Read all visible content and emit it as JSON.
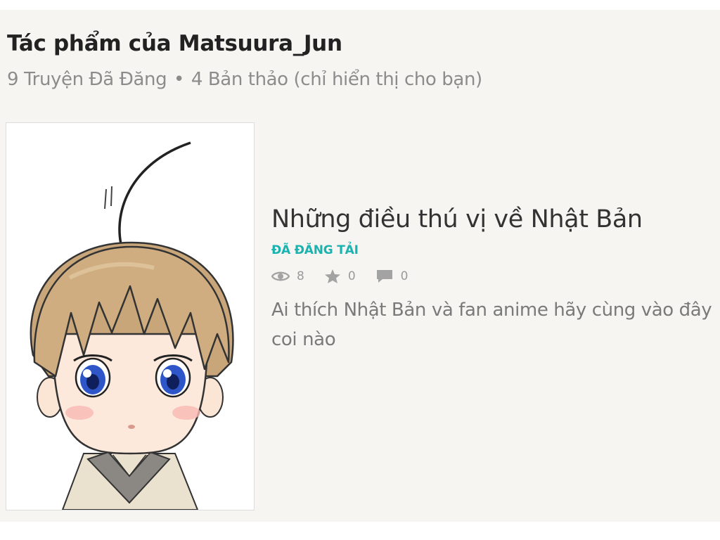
{
  "section": {
    "title": "Tác phẩm của Matsuura_Jun",
    "published": "9 Truyện Đã Đăng",
    "separator": "•",
    "drafts": "4 Bản thảo (chỉ hiển thị cho bạn)"
  },
  "story": {
    "title": "Những điều thú vị về Nhật Bản",
    "status": "ĐÃ ĐĂNG TẢI",
    "views": "8",
    "votes": "0",
    "comments": "0",
    "description": "Ai thích Nhật Bản và fan anime hãy cùng vào đây coi nào"
  },
  "colors": {
    "accent": "#1bb3b0",
    "panel_bg": "#f6f5f1",
    "muted_text": "#8c8c8c"
  },
  "icons": {
    "views": "eye-icon",
    "votes": "star-icon",
    "comments": "comment-icon"
  }
}
